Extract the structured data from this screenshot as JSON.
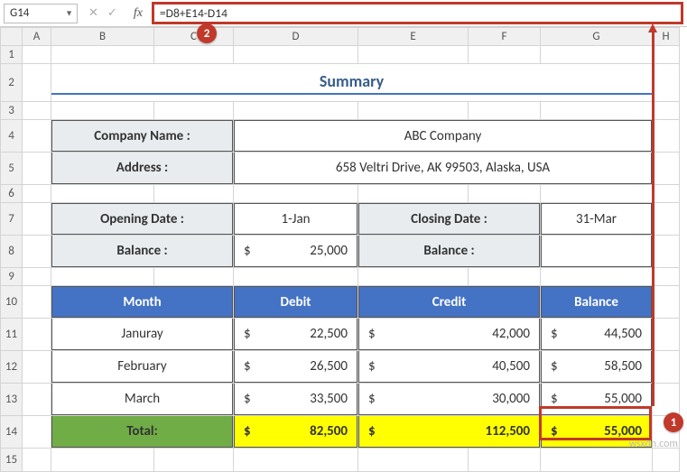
{
  "namebox": "G14",
  "formula": "=D8+E14-D14",
  "callouts": {
    "c1": "1",
    "c2": "2"
  },
  "cols": [
    "",
    "A",
    "B",
    "C",
    "D",
    "E",
    "F",
    "G",
    "H"
  ],
  "rows": [
    "1",
    "2",
    "3",
    "4",
    "5",
    "6",
    "7",
    "8",
    "9",
    "10",
    "11",
    "12",
    "13",
    "14",
    "15"
  ],
  "summary": {
    "title": "Summary",
    "company_label": "Company Name :",
    "company_value": "ABC Company",
    "address_label": "Address :",
    "address_value": "658 Veltri Drive, AK 99503, Alaska, USA",
    "open_label": "Opening Date :",
    "open_value": "1-Jan",
    "close_label": "Closing Date :",
    "close_value": "31-Mar",
    "balance_label": "Balance :",
    "balance_cur": "$",
    "balance_val": "25,000",
    "balance2_label": "Balance :"
  },
  "table": {
    "headers": {
      "month": "Month",
      "debit": "Debit",
      "credit": "Credit",
      "balance": "Balance"
    },
    "rows": [
      {
        "month": "Januray",
        "debit": "22,500",
        "credit": "42,000",
        "balance": "44,500"
      },
      {
        "month": "February",
        "debit": "26,500",
        "credit": "40,500",
        "balance": "58,500"
      },
      {
        "month": "March",
        "debit": "33,500",
        "credit": "30,000",
        "balance": "55,000"
      }
    ],
    "total_label": "Total:",
    "total": {
      "debit": "82,500",
      "credit": "112,500",
      "balance": "55,000"
    },
    "cur": "$"
  },
  "watermark": "wsxdn.com"
}
